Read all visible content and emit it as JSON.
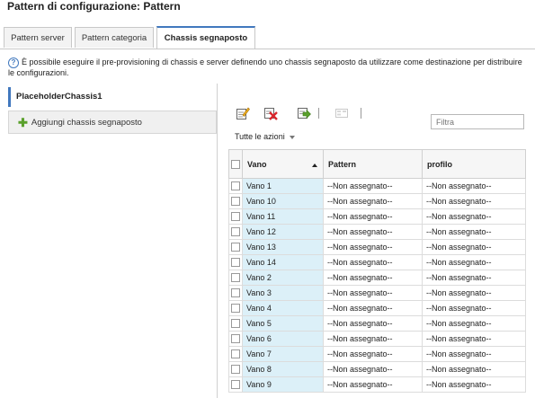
{
  "page": {
    "title": "Pattern di configurazione: Pattern"
  },
  "tabs": [
    {
      "label": "Pattern server"
    },
    {
      "label": "Pattern categoria"
    },
    {
      "label": "Chassis segnaposto"
    }
  ],
  "info": {
    "icon": "help-icon",
    "text": "È possibile eseguire il pre-provisioning di chassis e server definendo uno chassis segnaposto da utilizzare come destinazione per distribuire le configurazioni."
  },
  "sidebar": {
    "selected": "PlaceholderChassis1",
    "add_label": "Aggiungi chassis segnaposto"
  },
  "toolbar": {
    "icons": [
      "edit-icon",
      "delete-icon",
      "deploy-icon",
      "placeholder-icon"
    ],
    "filter_placeholder": "Filtra",
    "actions_label": "Tutte le azioni"
  },
  "table": {
    "columns": [
      "Vano",
      "Pattern",
      "profilo"
    ],
    "rows": [
      {
        "vano": "Vano 1",
        "pattern": "--Non assegnato--",
        "profilo": "--Non assegnato--"
      },
      {
        "vano": "Vano 10",
        "pattern": "--Non assegnato--",
        "profilo": "--Non assegnato--"
      },
      {
        "vano": "Vano 11",
        "pattern": "--Non assegnato--",
        "profilo": "--Non assegnato--"
      },
      {
        "vano": "Vano 12",
        "pattern": "--Non assegnato--",
        "profilo": "--Non assegnato--"
      },
      {
        "vano": "Vano 13",
        "pattern": "--Non assegnato--",
        "profilo": "--Non assegnato--"
      },
      {
        "vano": "Vano 14",
        "pattern": "--Non assegnato--",
        "profilo": "--Non assegnato--"
      },
      {
        "vano": "Vano 2",
        "pattern": "--Non assegnato--",
        "profilo": "--Non assegnato--"
      },
      {
        "vano": "Vano 3",
        "pattern": "--Non assegnato--",
        "profilo": "--Non assegnato--"
      },
      {
        "vano": "Vano 4",
        "pattern": "--Non assegnato--",
        "profilo": "--Non assegnato--"
      },
      {
        "vano": "Vano 5",
        "pattern": "--Non assegnato--",
        "profilo": "--Non assegnato--"
      },
      {
        "vano": "Vano 6",
        "pattern": "--Non assegnato--",
        "profilo": "--Non assegnato--"
      },
      {
        "vano": "Vano 7",
        "pattern": "--Non assegnato--",
        "profilo": "--Non assegnato--"
      },
      {
        "vano": "Vano 8",
        "pattern": "--Non assegnato--",
        "profilo": "--Non assegnato--"
      },
      {
        "vano": "Vano 9",
        "pattern": "--Non assegnato--",
        "profilo": "--Non assegnato--"
      }
    ]
  },
  "colors": {
    "accent": "#4178be",
    "selected_cell": "#dcf0f8",
    "add_green": "#5aa02c",
    "delete_red": "#d9262c"
  }
}
